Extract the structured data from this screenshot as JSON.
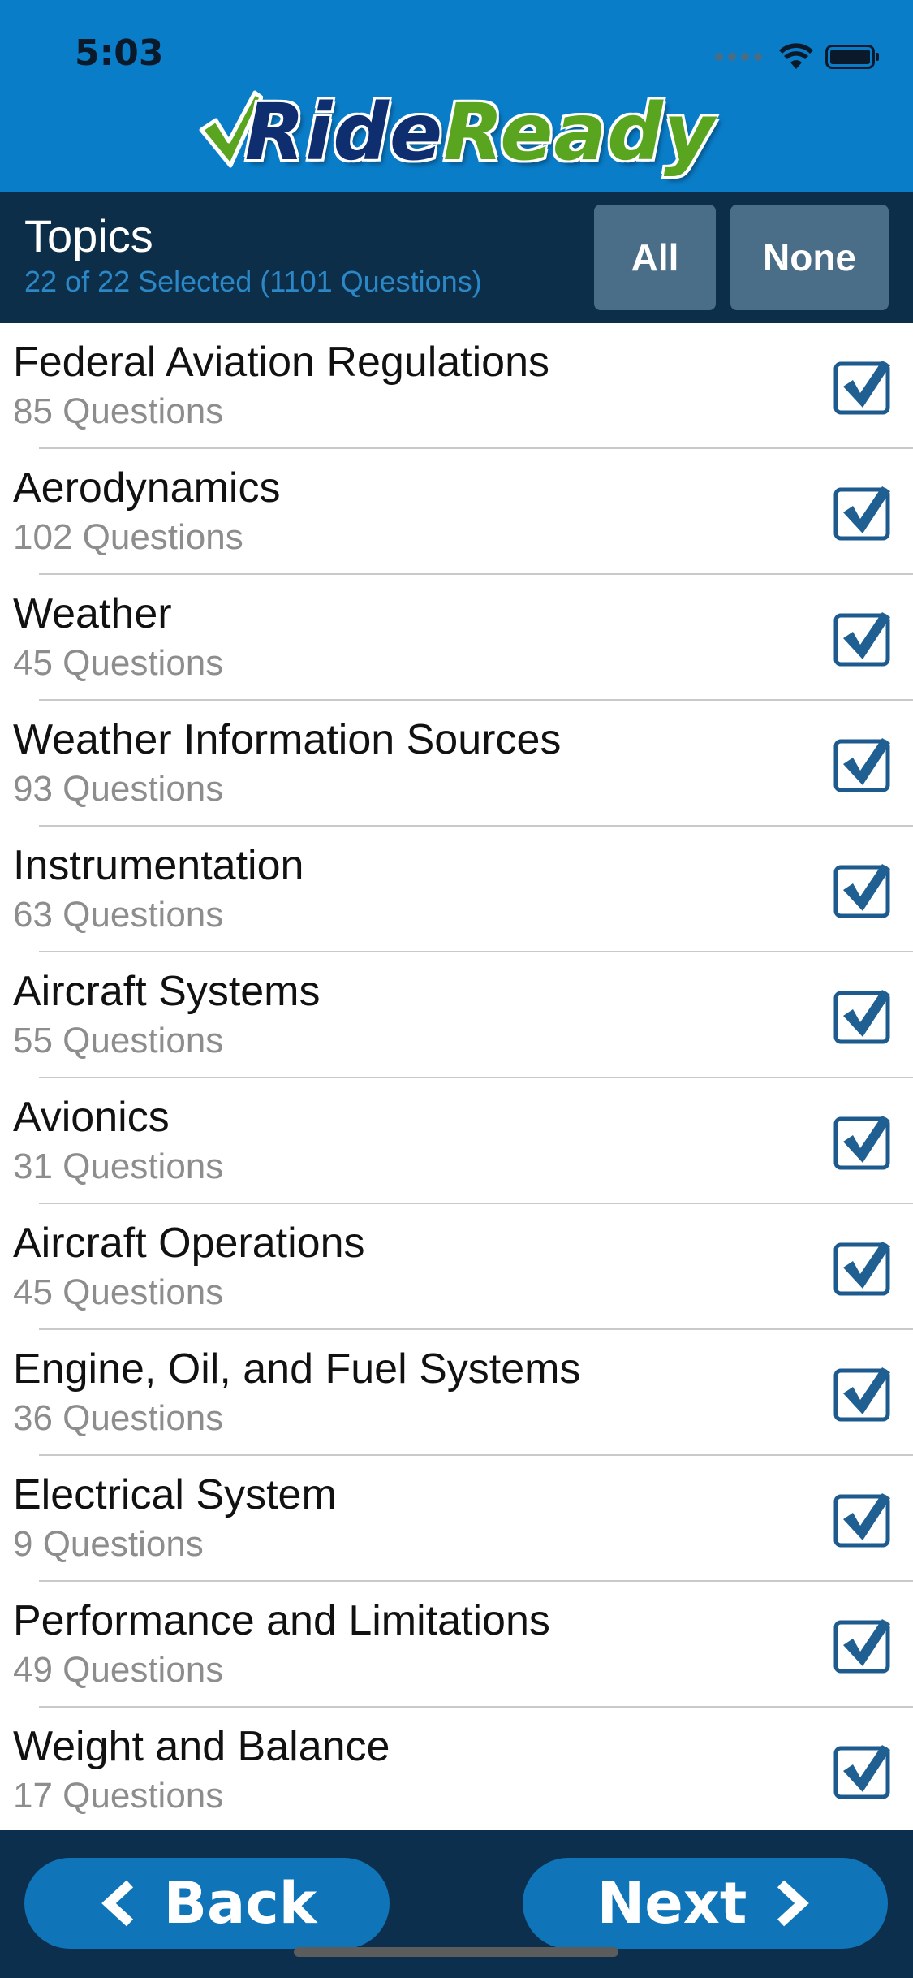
{
  "status_bar": {
    "time": "5:03"
  },
  "header": {
    "logo_part1": "Ride",
    "logo_part2": "Ready"
  },
  "topics": {
    "title": "Topics",
    "summary": "22 of 22 Selected (1101 Questions)",
    "all_label": "All",
    "none_label": "None"
  },
  "items": [
    {
      "title": "Federal Aviation Regulations",
      "count": "85 Questions",
      "checked": true
    },
    {
      "title": "Aerodynamics",
      "count": "102 Questions",
      "checked": true
    },
    {
      "title": "Weather",
      "count": "45 Questions",
      "checked": true
    },
    {
      "title": "Weather Information Sources",
      "count": "93 Questions",
      "checked": true
    },
    {
      "title": "Instrumentation",
      "count": "63 Questions",
      "checked": true
    },
    {
      "title": "Aircraft Systems",
      "count": "55 Questions",
      "checked": true
    },
    {
      "title": "Avionics",
      "count": "31 Questions",
      "checked": true
    },
    {
      "title": "Aircraft Operations",
      "count": "45 Questions",
      "checked": true
    },
    {
      "title": "Engine, Oil, and Fuel Systems",
      "count": "36 Questions",
      "checked": true
    },
    {
      "title": "Electrical System",
      "count": "9 Questions",
      "checked": true
    },
    {
      "title": "Performance and Limitations",
      "count": "49 Questions",
      "checked": true
    },
    {
      "title": "Weight and Balance",
      "count": "17 Questions",
      "checked": true
    }
  ],
  "footer": {
    "back_label": "Back",
    "next_label": "Next"
  },
  "colors": {
    "header_blue": "#0a7dc9",
    "dark_navy": "#0c2e49",
    "accent_blue": "#2b87c6",
    "button_blue": "#0f74b8",
    "checkbox_blue": "#1d5a8e"
  },
  "icons": {
    "checkbox": "checkbox-checked-icon",
    "back": "chevron-left-icon",
    "next": "chevron-right-icon",
    "wifi": "wifi-icon",
    "battery": "battery-icon"
  }
}
